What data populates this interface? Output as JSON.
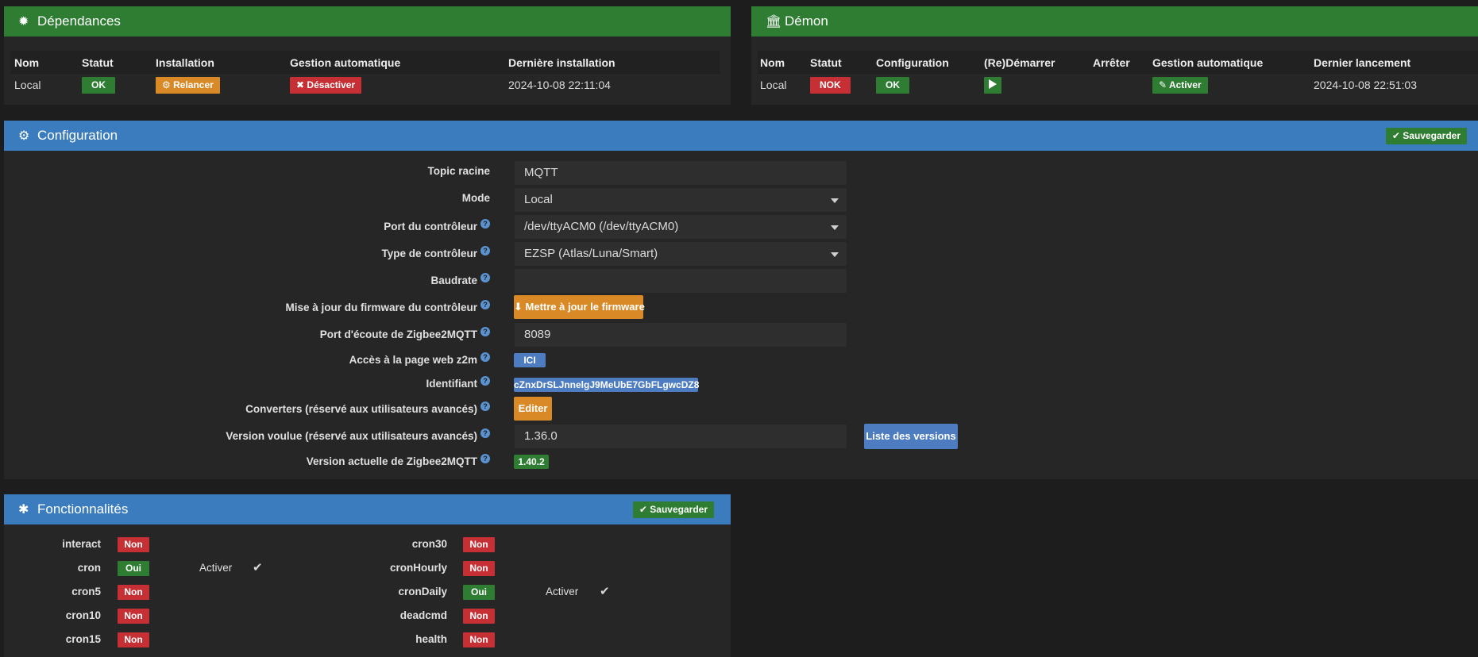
{
  "dependances": {
    "title": "Dépendances",
    "headers": [
      "Nom",
      "Statut",
      "Installation",
      "Gestion automatique",
      "Dernière installation"
    ],
    "row": {
      "nom": "Local",
      "statut": "OK",
      "installation": "Relancer",
      "gestion": "Désactiver",
      "derniere": "2024-10-08 22:11:04"
    }
  },
  "demon": {
    "title": "Démon",
    "headers": [
      "Nom",
      "Statut",
      "Configuration",
      "(Re)Démarrer",
      "Arrêter",
      "Gestion automatique",
      "Dernier lancement"
    ],
    "row": {
      "nom": "Local",
      "statut": "NOK",
      "configuration": "OK",
      "gestion": "Activer",
      "dernier": "2024-10-08 22:51:03"
    }
  },
  "configuration": {
    "title": "Configuration",
    "save_label": "Sauvegarder",
    "fields": {
      "topic_label": "Topic racine",
      "topic_value": "MQTT",
      "mode_label": "Mode",
      "mode_value": "Local",
      "port_label": "Port du contrôleur",
      "port_value": "/dev/ttyACM0 (/dev/ttyACM0)",
      "type_label": "Type de contrôleur",
      "type_value": "EZSP (Atlas/Luna/Smart)",
      "baudrate_label": "Baudrate",
      "baudrate_value": "",
      "firmware_label": "Mise à jour du firmware du contrôleur",
      "firmware_button": "Mettre à jour le firmware",
      "listen_label": "Port d'écoute de Zigbee2MQTT",
      "listen_value": "8089",
      "web_label": "Accès à la page web z2m",
      "web_button": "ICI",
      "id_label": "Identifiant",
      "id_value": "cZnxDrSLJnnelgJ9MeUbE7GbFLgwcDZ8",
      "converters_label": "Converters (réservé aux utilisateurs avancés)",
      "converters_button": "Editer",
      "version_wanted_label": "Version voulue (réservé aux utilisateurs avancés)",
      "version_wanted_value": "1.36.0",
      "versions_list_button": "Liste des versions",
      "version_current_label": "Version actuelle de Zigbee2MQTT",
      "version_current_value": "1.40.2"
    }
  },
  "fonctionnalites": {
    "title": "Fonctionnalités",
    "save_label": "Sauvegarder",
    "activer_label": "Activer",
    "left": [
      {
        "name": "interact",
        "value": "Non"
      },
      {
        "name": "cron",
        "value": "Oui"
      },
      {
        "name": "cron5",
        "value": "Non"
      },
      {
        "name": "cron10",
        "value": "Non"
      },
      {
        "name": "cron15",
        "value": "Non"
      }
    ],
    "right": [
      {
        "name": "cron30",
        "value": "Non"
      },
      {
        "name": "cronHourly",
        "value": "Non"
      },
      {
        "name": "cronDaily",
        "value": "Oui"
      },
      {
        "name": "deadcmd",
        "value": "Non"
      },
      {
        "name": "health",
        "value": "Non"
      }
    ]
  },
  "colors": {
    "green": "#2e7d32",
    "blue": "#3a7cbd",
    "red": "#c62f33",
    "orange": "#d98a27"
  }
}
